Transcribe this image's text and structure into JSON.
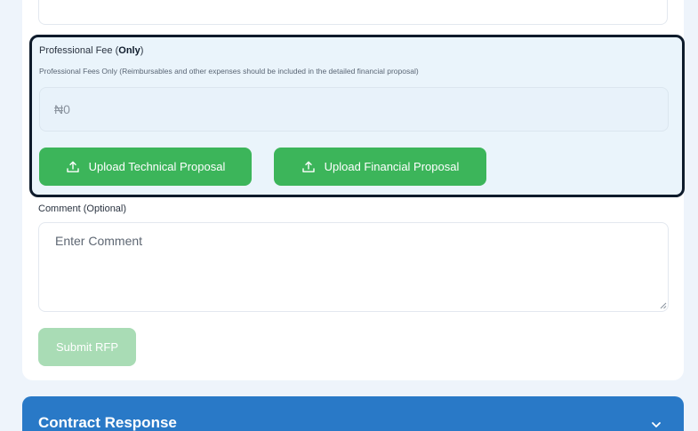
{
  "fee": {
    "label_prefix": "Professional Fee (",
    "label_bold": "Only",
    "label_suffix": ")",
    "help": "Professional Fees Only (Reimbursables and other expenses should be included in the detailed financial proposal)",
    "placeholder": "₦0",
    "upload_technical_label": "Upload Technical Proposal",
    "upload_financial_label": "Upload Financial Proposal"
  },
  "comment": {
    "label": "Comment (Optional)",
    "placeholder": "Enter Comment"
  },
  "submit_label": "Submit RFP",
  "accordion": {
    "title": "Contract Response"
  },
  "colors": {
    "highlight_border": "#0e1b2b",
    "upload_green": "#3cb55a",
    "submit_disabled_green": "#a9dcb5",
    "accordion_blue": "#2979c7"
  },
  "icons": {
    "upload": "upload-icon",
    "chevron": "chevron-down-icon"
  }
}
